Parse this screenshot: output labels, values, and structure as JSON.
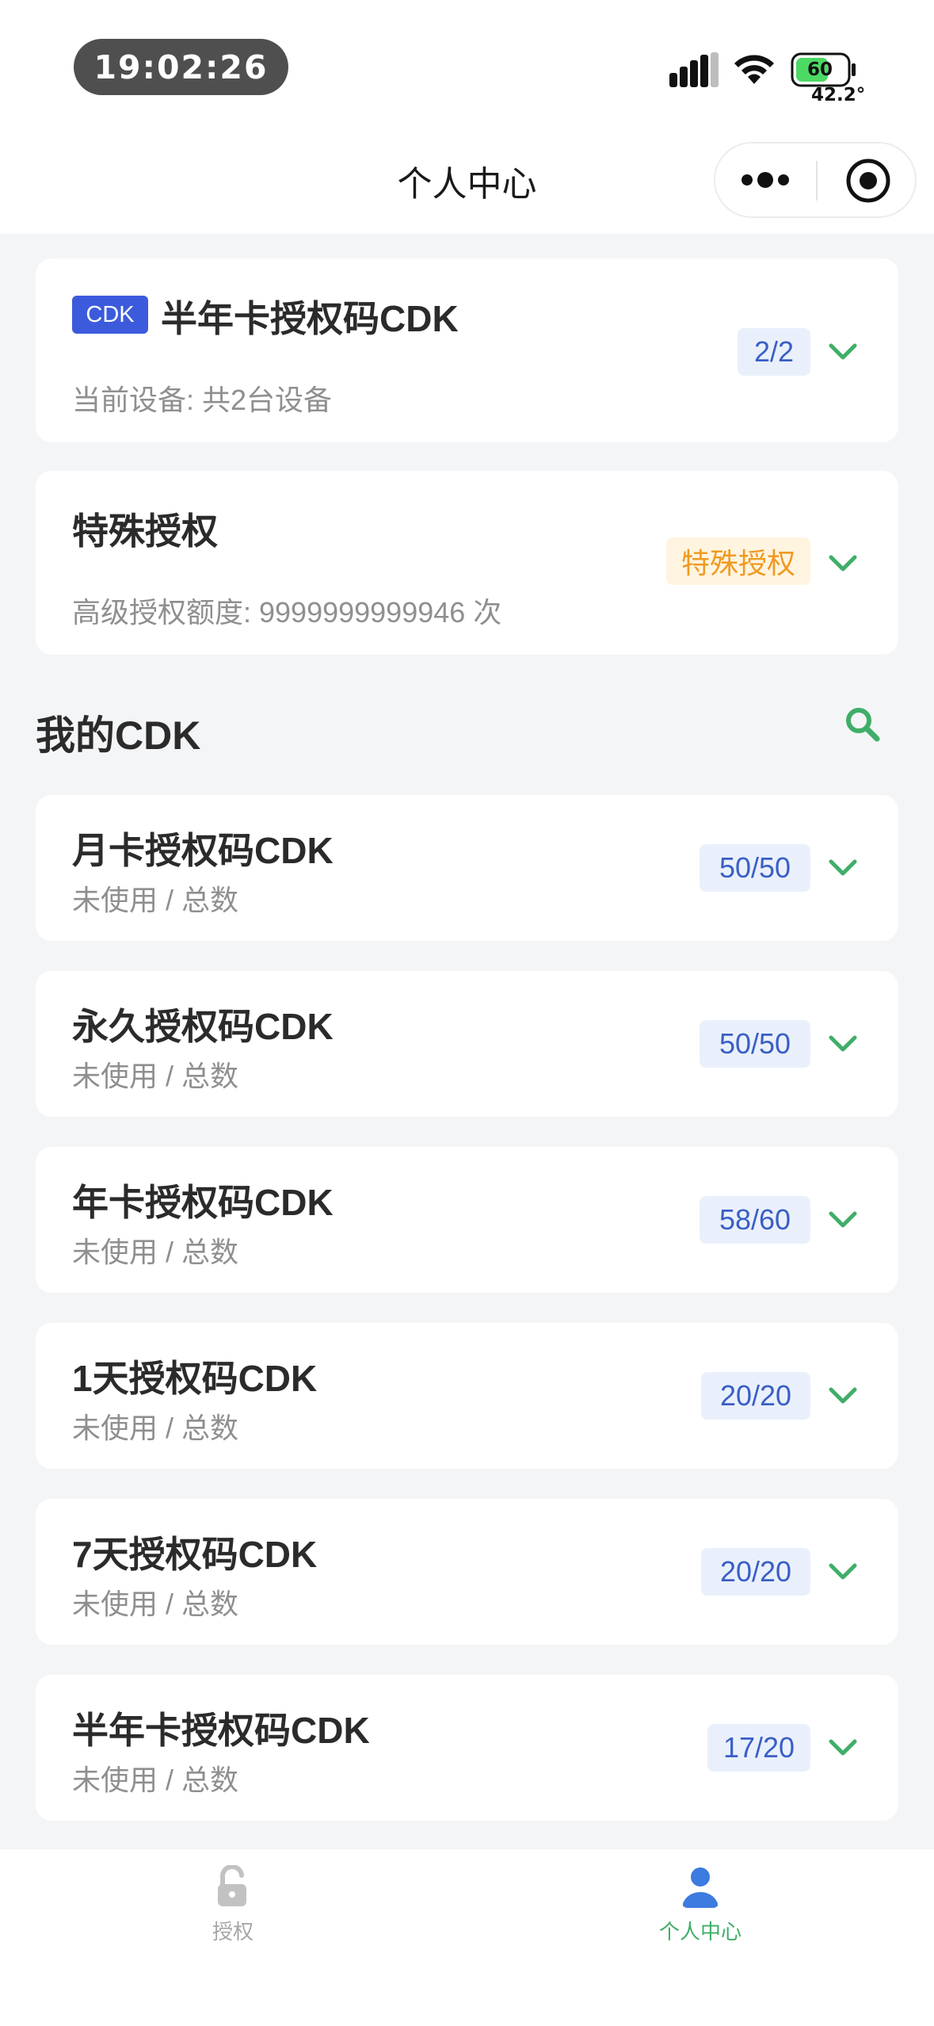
{
  "status_bar": {
    "time": "19:02:26",
    "battery_level": "60",
    "temperature": "42.2°"
  },
  "nav": {
    "title": "个人中心"
  },
  "authorizations": [
    {
      "tag": "CDK",
      "title": "半年卡授权码CDK",
      "subtitle": "当前设备: 共2台设备",
      "badge": "2/2"
    },
    {
      "title": "特殊授权",
      "subtitle": "高级授权额度: 9999999999946 次",
      "badge": "特殊授权"
    }
  ],
  "my_cdk": {
    "title": "我的CDK",
    "items": [
      {
        "title": "月卡授权码CDK",
        "subtitle": "未使用 / 总数",
        "count": "50/50"
      },
      {
        "title": "永久授权码CDK",
        "subtitle": "未使用 / 总数",
        "count": "50/50"
      },
      {
        "title": "年卡授权码CDK",
        "subtitle": "未使用 / 总数",
        "count": "58/60"
      },
      {
        "title": "1天授权码CDK",
        "subtitle": "未使用 / 总数",
        "count": "20/20"
      },
      {
        "title": "7天授权码CDK",
        "subtitle": "未使用 / 总数",
        "count": "20/20"
      },
      {
        "title": "半年卡授权码CDK",
        "subtitle": "未使用 / 总数",
        "count": "17/20"
      }
    ]
  },
  "tab_bar": {
    "tabs": [
      {
        "label": "授权",
        "icon": "lock-icon",
        "active": false
      },
      {
        "label": "个人中心",
        "icon": "user-icon",
        "active": true
      }
    ]
  },
  "colors": {
    "accent": "#3fae68",
    "cdk_tag": "#3c5bdc",
    "count_badge_text": "#3a5fc6",
    "special_badge_text": "#ef9a20",
    "inactive_tab": "#a7a7a7",
    "active_tab_icon": "#3d7be0"
  }
}
